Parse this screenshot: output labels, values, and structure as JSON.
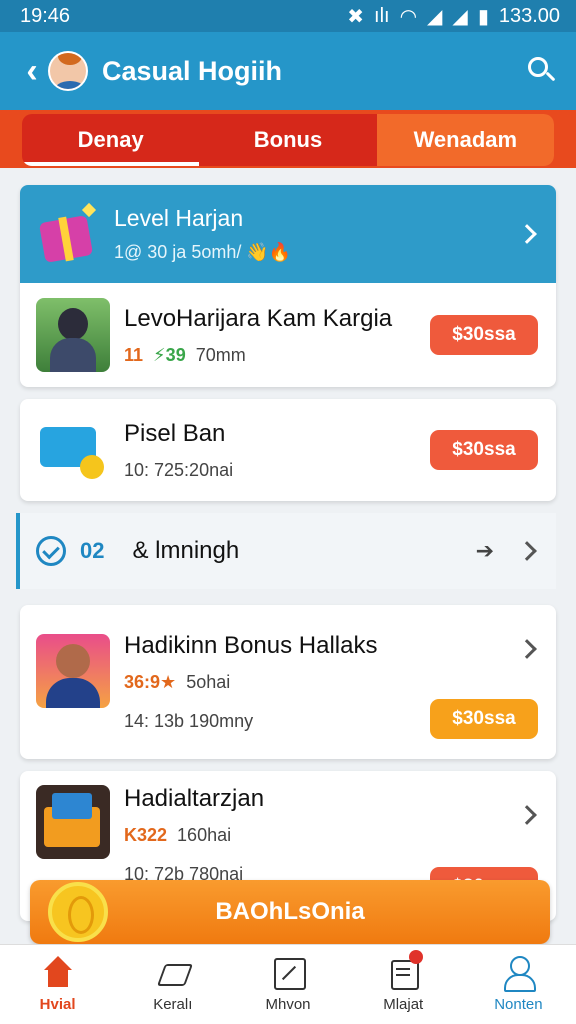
{
  "status_bar": {
    "time": "19:46",
    "battery": "133.00",
    "icons": [
      "mute-icon",
      "vibrate-icon",
      "wifi-icon",
      "signal-icon",
      "signal-icon",
      "battery-icon"
    ]
  },
  "app_bar": {
    "title": "Casual Hogiih"
  },
  "tabs": [
    {
      "label": "Denay",
      "active": true
    },
    {
      "label": "Bonus",
      "active": false
    },
    {
      "label": "Wenadam",
      "active": false
    }
  ],
  "featured": {
    "title": "Level Harjan",
    "subtitle": "1@ 30 ja 5omh/ 👋🔥"
  },
  "items": [
    {
      "title": "LevoHarijara Kam Kargia",
      "meta_a": "11",
      "meta_b": "⚡39",
      "meta_c": "70mm",
      "price": "$30ssa"
    },
    {
      "title": "Pisel Ban",
      "meta_c": "10: 725:20nai",
      "price": "$30ssa"
    }
  ],
  "section": {
    "count": "02",
    "label": "& lmningh",
    "arrow": "➔"
  },
  "items2": [
    {
      "title": "Hadikinn Bonus Hallaks",
      "meta_a": "36:9★",
      "meta_c": "5ohai",
      "meta2": "14: 13b 190mny",
      "price": "$30ssa"
    },
    {
      "title": "Hadialtarzjan",
      "meta_a": "K322",
      "meta_c": "160hai",
      "meta2": "10: 72b 780nai",
      "price": "$30ssa"
    }
  ],
  "cta": {
    "label": "BAOhLsOnia"
  },
  "bottom_nav": [
    {
      "label": "Hvial",
      "icon": "home-icon"
    },
    {
      "label": "Keralı",
      "icon": "send-icon"
    },
    {
      "label": "Mhvon",
      "icon": "chart-icon"
    },
    {
      "label": "Mlajat",
      "icon": "document-icon"
    },
    {
      "label": "Nonten",
      "icon": "user-icon"
    }
  ],
  "colors": {
    "primary": "#2596c9",
    "accent": "#e84a1e",
    "button": "#ef5a3c",
    "cta": "#f7a11b"
  }
}
